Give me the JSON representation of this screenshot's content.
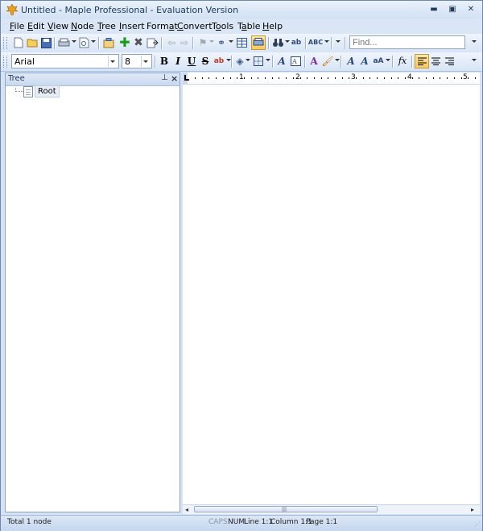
{
  "window": {
    "title": "Untitled - Maple Professional - Evaluation Version",
    "controls": {
      "minimize": "▬",
      "restore": "▣",
      "close": "✕"
    }
  },
  "menu": [
    {
      "label": "File"
    },
    {
      "label": "Edit"
    },
    {
      "label": "View"
    },
    {
      "label": "Node"
    },
    {
      "label": "Tree"
    },
    {
      "label": "Insert"
    },
    {
      "label": "Format"
    },
    {
      "label": "Convert"
    },
    {
      "label": "Tools"
    },
    {
      "label": "Table"
    },
    {
      "label": "Help"
    }
  ],
  "toolbar": {
    "find_placeholder": "Find...",
    "icons": [
      "new-document-icon",
      "open-folder-icon",
      "save-icon",
      "print-icon",
      "print-preview-icon",
      "node-properties-icon",
      "add-node-icon",
      "delete-node-icon",
      "move-node-icon",
      "back-icon",
      "forward-icon",
      "flag-icon",
      "link-icon",
      "table-icon",
      "printer-layout-icon",
      "find-binoculars-icon",
      "replace-icon",
      "spell-check-icon"
    ],
    "colors": {
      "add": "#1c9a1c",
      "delete": "#555555"
    }
  },
  "format_toolbar": {
    "font": "Arial",
    "size": "8",
    "bold": "B",
    "italic": "I",
    "underline": "U",
    "strike": "S",
    "function": "fx",
    "active_color": "#f9c95a"
  },
  "tree_pane": {
    "title": "Tree",
    "pin": "⊥",
    "close": "×",
    "root_label": "Root"
  },
  "ruler": {
    "numbers": [
      "1",
      "2",
      "3",
      "4",
      "5"
    ]
  },
  "scrollbar": {
    "left": "◂",
    "right": "▸",
    "grip": "|||"
  },
  "status": {
    "total": "Total 1 node",
    "caps": "CAPS",
    "num": "NUM",
    "line": "Line 1:1",
    "column": "Column 1:1",
    "page": "Page 1:1"
  }
}
